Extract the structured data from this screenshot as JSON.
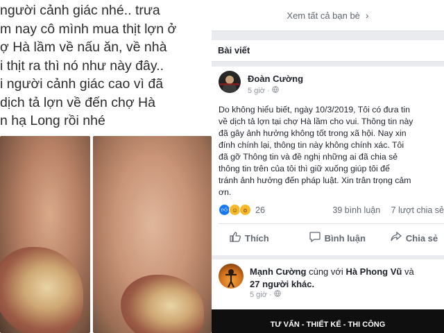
{
  "caption": {
    "lines": [
      "người cảnh giác nhé.. trưa",
      "m nay cô mình mua thịt lợn ở",
      "ợ Hà lầm về nấu ăn, về nhà",
      "i thịt ra thì nó như này đây..",
      "i người cảnh giác cao vì đã",
      "dịch tả lợn về đến chợ Hà",
      "n hạ Long rồi nhé"
    ]
  },
  "friends_link": {
    "label": "Xem tất cả bạn bè",
    "icon": "chevron-right-icon"
  },
  "section_title": "Bài viết",
  "post": {
    "author": "Đoàn Cường",
    "time": "5 giờ ·",
    "privacy_icon": "globe-icon",
    "more_icon": "more-options-icon",
    "text_lines": [
      "Do không hiểu biết, ngày 10/3/2019, Tôi có đưa tin",
      "về dịch tả lợn tại chợ Hà lầm cho vui. Thông tin này",
      "đã gây ảnh hưởng không tốt trong xã hội. Nay xin",
      "đính chính lại, thông tin này không chính xác. Tôi",
      "đã gỡ Thông tin và đề nghị những ai đã chia sẻ",
      "thông tin trên của tôi thì giữ xuống giúp tôi để",
      "tránh ảnh hưởng đến pháp luật. Xin trân trọng cảm",
      "ơn."
    ],
    "reaction_count": "26",
    "comments": "39 bình luận",
    "shares": "7 lượt chia sẻ",
    "actions": {
      "like": "Thích",
      "comment": "Bình luận",
      "share": "Chia sẻ"
    }
  },
  "post2": {
    "name": "Mạnh Cường",
    "with_text": " cùng với ",
    "tagged": "Hà Phong Vũ",
    "and_text": " và",
    "others": "27 người khác.",
    "time": "5 giờ ·"
  },
  "banner": {
    "text": "TƯ VẤN - THIẾT KẾ - THI CÔNG"
  }
}
